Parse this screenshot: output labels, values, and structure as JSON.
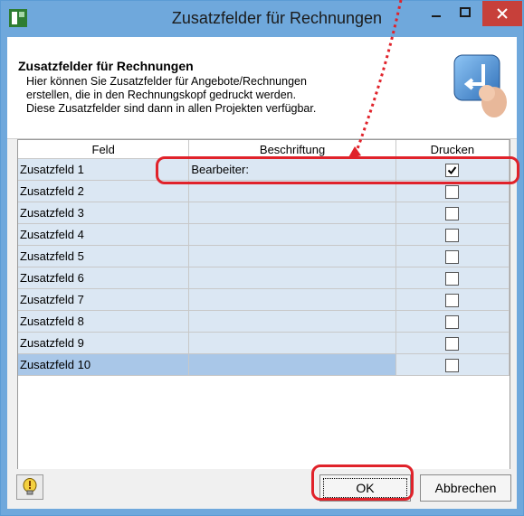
{
  "window": {
    "title": "Zusatzfelder für Rechnungen",
    "minimize_glyph": "—",
    "maximize_glyph": "□",
    "close_glyph": "✕"
  },
  "header": {
    "title": "Zusatzfelder für Rechnungen",
    "description": "Hier können Sie Zusatzfelder für Angebote/Rechnungen\nerstellen, die in den Rechnungskopf gedruckt werden.\nDiese Zusatzfelder sind dann in allen Projekten verfügbar."
  },
  "table": {
    "columns": [
      "Feld",
      "Beschriftung",
      "Drucken"
    ],
    "rows": [
      {
        "feld": "Zusatzfeld 1",
        "beschriftung": "Bearbeiter:",
        "drucken": true
      },
      {
        "feld": "Zusatzfeld 2",
        "beschriftung": "",
        "drucken": false
      },
      {
        "feld": "Zusatzfeld 3",
        "beschriftung": "",
        "drucken": false
      },
      {
        "feld": "Zusatzfeld 4",
        "beschriftung": "",
        "drucken": false
      },
      {
        "feld": "Zusatzfeld 5",
        "beschriftung": "",
        "drucken": false
      },
      {
        "feld": "Zusatzfeld 6",
        "beschriftung": "",
        "drucken": false
      },
      {
        "feld": "Zusatzfeld 7",
        "beschriftung": "",
        "drucken": false
      },
      {
        "feld": "Zusatzfeld 8",
        "beschriftung": "",
        "drucken": false
      },
      {
        "feld": "Zusatzfeld 9",
        "beschriftung": "",
        "drucken": false
      },
      {
        "feld": "Zusatzfeld 10",
        "beschriftung": "",
        "drucken": false
      }
    ]
  },
  "buttons": {
    "ok_label": "OK",
    "cancel_label": "Abbrechen"
  },
  "colors": {
    "accent": "#6fa8dc",
    "highlight": "#e0222a"
  }
}
